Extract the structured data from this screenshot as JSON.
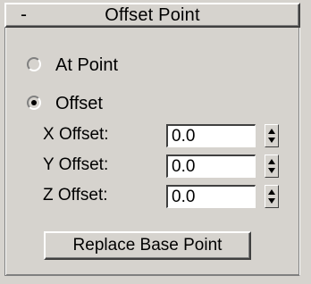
{
  "rollout": {
    "collapse_sign": "-",
    "title": "Offset Point"
  },
  "mode": {
    "options": [
      {
        "label": "At Point",
        "selected": false
      },
      {
        "label": "Offset",
        "selected": true
      }
    ]
  },
  "offsets": [
    {
      "label": "X Offset:",
      "value": "0.0"
    },
    {
      "label": "Y Offset:",
      "value": "0.0"
    },
    {
      "label": "Z Offset:",
      "value": "0.0"
    }
  ],
  "button": {
    "label": "Replace Base Point"
  }
}
